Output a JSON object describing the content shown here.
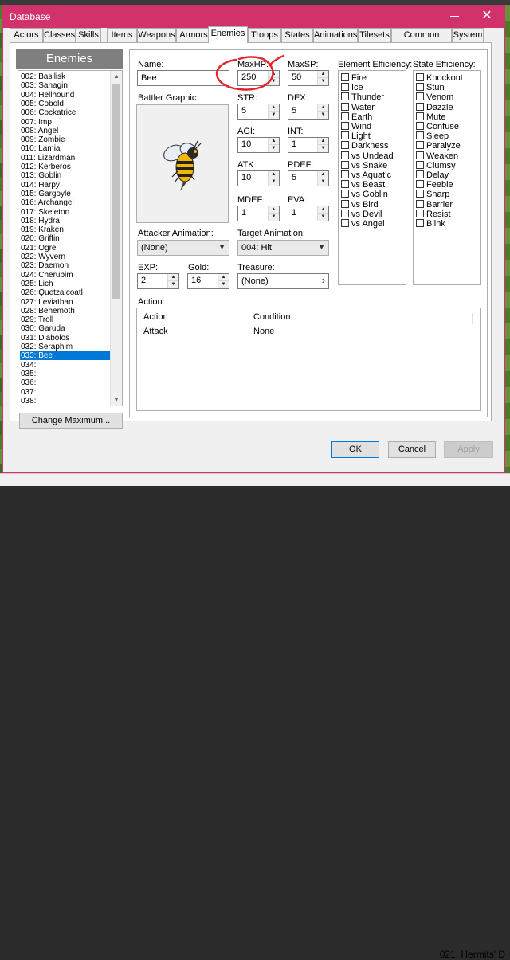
{
  "background": {
    "status_text": "021: Hermits' D"
  },
  "window": {
    "title": "Database",
    "close_glyph": "✕",
    "accent_color": "#d1326b"
  },
  "tabs": [
    {
      "label": "Actors"
    },
    {
      "label": "Classes"
    },
    {
      "label": "Skills"
    },
    {
      "label": "Items"
    },
    {
      "label": "Weapons"
    },
    {
      "label": "Armors"
    },
    {
      "label": "Enemies",
      "active": true
    },
    {
      "label": "Troops"
    },
    {
      "label": "States"
    },
    {
      "label": "Animations"
    },
    {
      "label": "Tilesets"
    },
    {
      "label": "Common Events"
    },
    {
      "label": "System"
    }
  ],
  "enemies_panel": {
    "title": "Enemies",
    "items": [
      "002: Basilisk",
      "003: Sahagin",
      "004: Hellhound",
      "005: Cobold",
      "006: Cockatrice",
      "007: Imp",
      "008: Angel",
      "009: Zombie",
      "010: Lamia",
      "011: Lizardman",
      "012: Kerberos",
      "013: Goblin",
      "014: Harpy",
      "015: Gargoyle",
      "016: Archangel",
      "017: Skeleton",
      "018: Hydra",
      "019: Kraken",
      "020: Griffin",
      "021: Ogre",
      "022: Wyvern",
      "023: Daemon",
      "024: Cherubim",
      "025: Lich",
      "026: Quetzalcoatl",
      "027: Leviathan",
      "028: Behemoth",
      "029: Troll",
      "030: Garuda",
      "031: Diabolos",
      "032: Seraphim",
      "033: Bee",
      "034:",
      "035:",
      "036:",
      "037:",
      "038:"
    ],
    "selected_index": 31,
    "change_max_label": "Change Maximum..."
  },
  "form": {
    "name_label": "Name:",
    "name_value": "Bee",
    "battler_label": "Battler Graphic:",
    "maxhp_label": "MaxHP:",
    "maxhp_value": "250",
    "maxsp_label": "MaxSP:",
    "maxsp_value": "50",
    "str_label": "STR:",
    "str_value": "5",
    "dex_label": "DEX:",
    "dex_value": "5",
    "agi_label": "AGI:",
    "agi_value": "10",
    "int_label": "INT:",
    "int_value": "1",
    "atk_label": "ATK:",
    "atk_value": "10",
    "pdef_label": "PDEF:",
    "pdef_value": "5",
    "mdef_label": "MDEF:",
    "mdef_value": "1",
    "eva_label": "EVA:",
    "eva_value": "1",
    "attacker_anim_label": "Attacker Animation:",
    "attacker_anim_value": "(None)",
    "target_anim_label": "Target Animation:",
    "target_anim_value": "004: Hit",
    "exp_label": "EXP:",
    "exp_value": "2",
    "gold_label": "Gold:",
    "gold_value": "16",
    "treasure_label": "Treasure:",
    "treasure_value": "(None)",
    "treasure_button": "›"
  },
  "element_efficiency": {
    "label": "Element Efficiency:",
    "items": [
      "Fire",
      "Ice",
      "Thunder",
      "Water",
      "Earth",
      "Wind",
      "Light",
      "Darkness",
      "vs Undead",
      "vs Snake",
      "vs Aquatic",
      "vs Beast",
      "vs Goblin",
      "vs Bird",
      "vs Devil",
      "vs Angel"
    ]
  },
  "state_efficiency": {
    "label": "State Efficiency:",
    "items": [
      "Knockout",
      "Stun",
      "Venom",
      "Dazzle",
      "Mute",
      "Confuse",
      "Sleep",
      "Paralyze",
      "Weaken",
      "Clumsy",
      "Delay",
      "Feeble",
      "Sharp",
      "Barrier",
      "Resist",
      "Blink"
    ]
  },
  "action": {
    "label": "Action:",
    "headers": {
      "action": "Action",
      "condition": "Condition"
    },
    "rows": [
      {
        "action": "Attack",
        "condition": "None"
      }
    ]
  },
  "footer": {
    "ok": "OK",
    "cancel": "Cancel",
    "apply": "Apply"
  }
}
